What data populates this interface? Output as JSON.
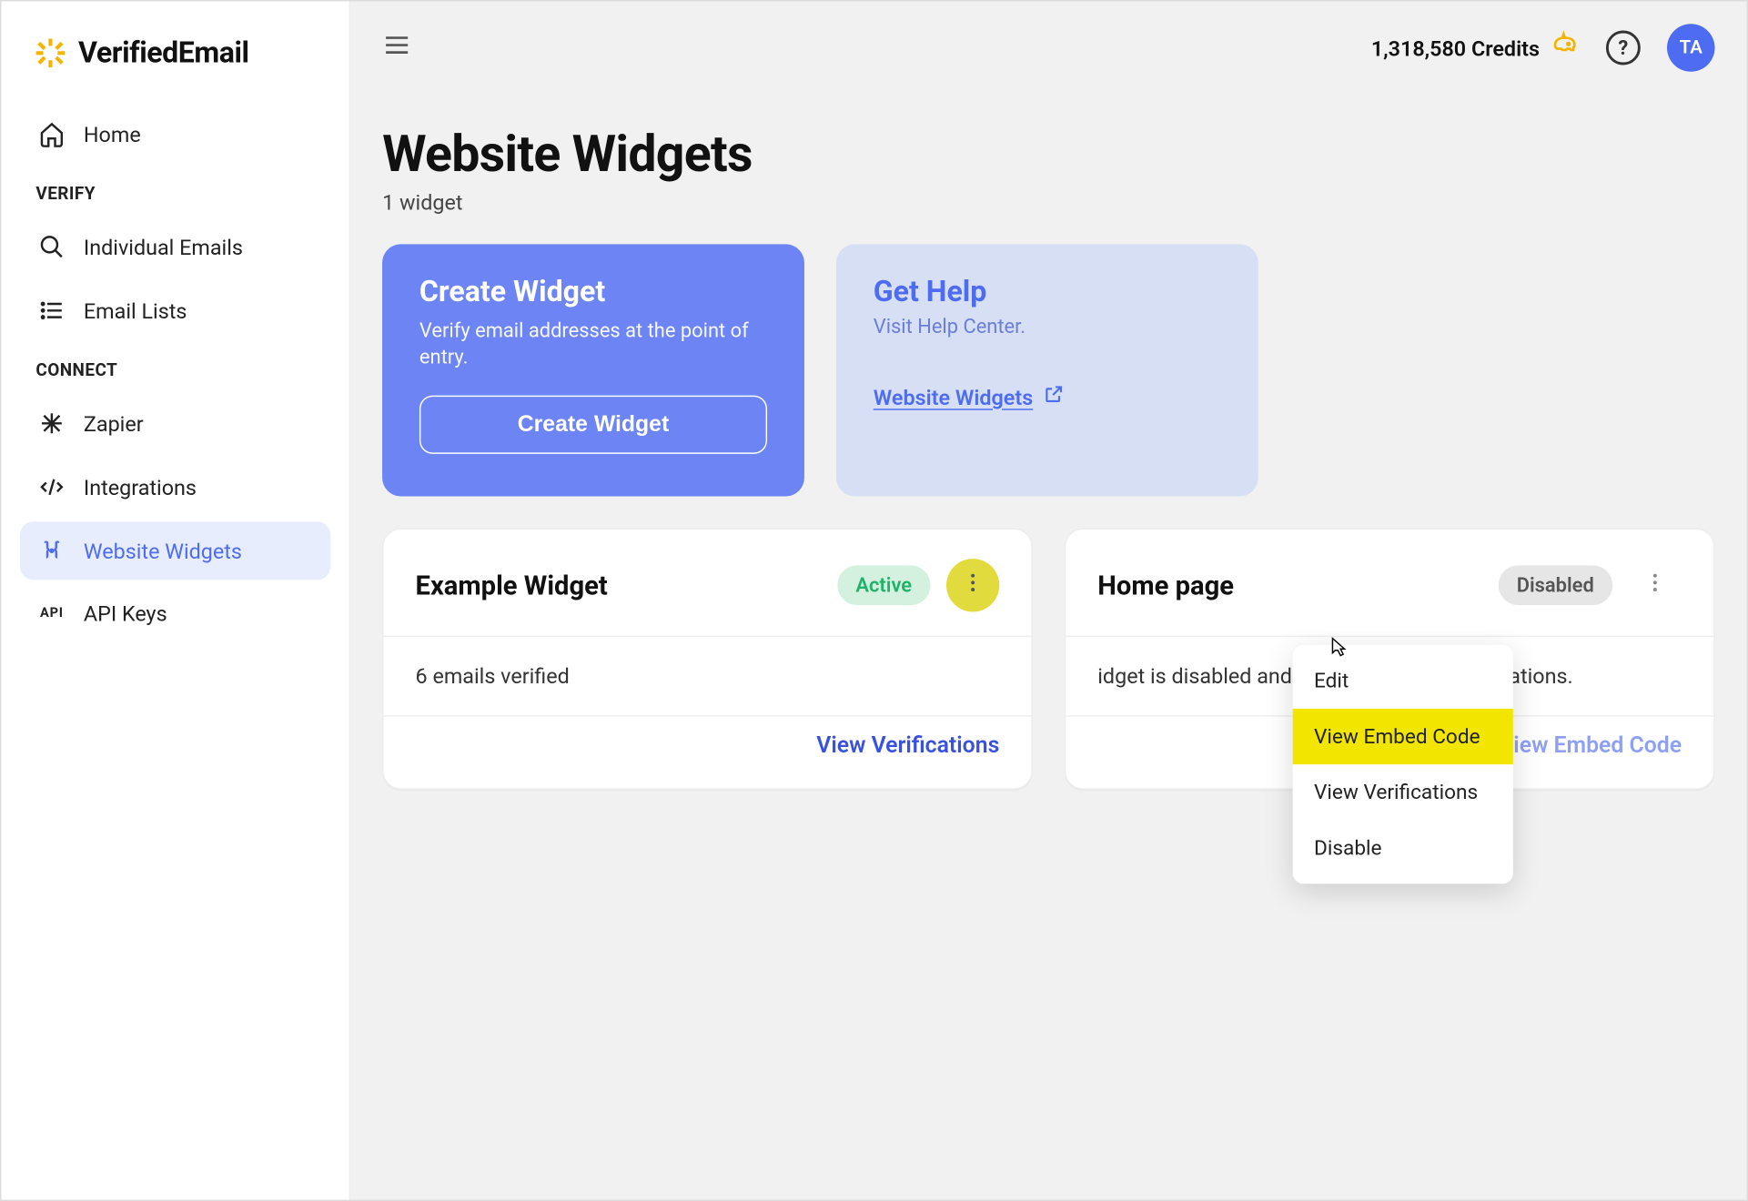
{
  "app": {
    "name": "VerifiedEmail"
  },
  "topbar": {
    "credits_text": "1,318,580 Credits",
    "avatar_initials": "TA"
  },
  "sidebar": {
    "home": "Home",
    "sections": {
      "verify": "VERIFY",
      "connect": "CONNECT"
    },
    "items": {
      "individual_emails": "Individual Emails",
      "email_lists": "Email Lists",
      "zapier": "Zapier",
      "integrations": "Integrations",
      "website_widgets": "Website Widgets",
      "api_keys": "API Keys"
    }
  },
  "page": {
    "title": "Website Widgets",
    "subtitle": "1 widget"
  },
  "promo": {
    "create": {
      "title": "Create Widget",
      "desc": "Verify email addresses at the point of entry.",
      "button": "Create Widget"
    },
    "help": {
      "title": "Get Help",
      "desc": "Visit Help Center.",
      "link": "Website Widgets "
    }
  },
  "widgets": [
    {
      "name": "Example Widget",
      "status": "Active",
      "body": "6 emails verified",
      "footer_link": "View Verifications"
    },
    {
      "name": "Home page",
      "status": "Disabled",
      "body": "idget is disabled and will no longer perform ations.",
      "footer_link": "View Embed Code"
    }
  ],
  "dropdown": {
    "edit": "Edit",
    "view_embed_code": "View Embed Code",
    "view_verifications": "View Verifications",
    "disable": "Disable"
  }
}
